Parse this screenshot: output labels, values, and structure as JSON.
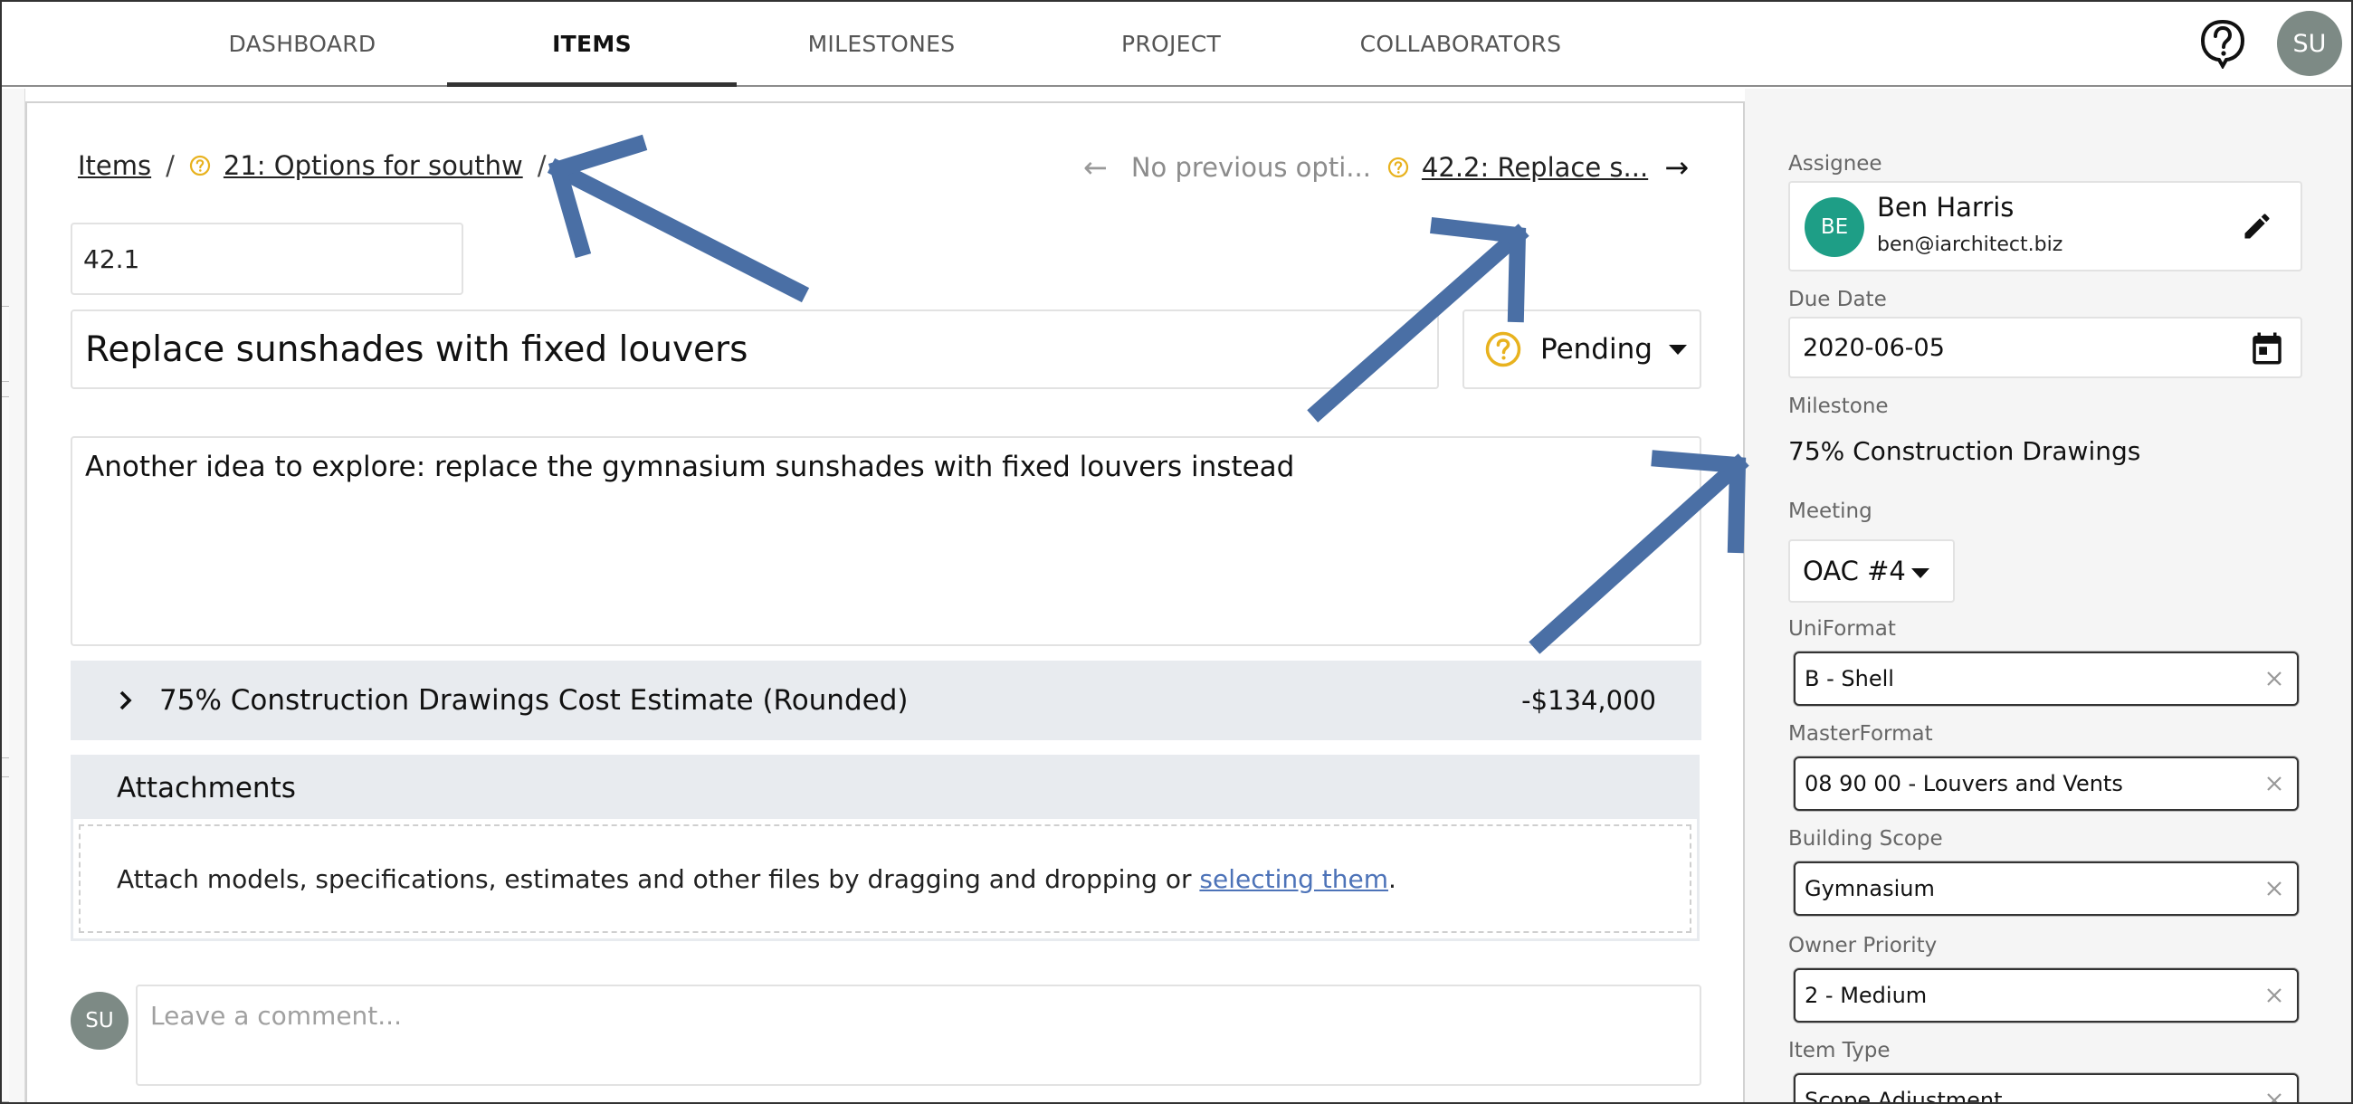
{
  "nav": {
    "tabs": [
      "DASHBOARD",
      "ITEMS",
      "MILESTONES",
      "PROJECT",
      "COLLABORATORS"
    ],
    "active_tab": "ITEMS",
    "user_initials": "SU"
  },
  "breadcrumb": {
    "root": "Items",
    "separator": "/",
    "parent": "21: Options for southw"
  },
  "option_nav": {
    "prev_arrow": "←",
    "prev_text": "No previous opti...",
    "next_text": "42.2: Replace s...",
    "next_arrow": "→"
  },
  "item": {
    "number": "42.1",
    "title": "Replace sunshades with fixed louvers",
    "status": "Pending",
    "description": "Another idea to explore: replace the gymnasium sunshades with fixed louvers instead"
  },
  "cost": {
    "label": "75% Construction Drawings Cost Estimate (Rounded)",
    "amount": "-$134,000"
  },
  "attachments": {
    "title": "Attachments",
    "drop_text": "Attach models, specifications, estimates and other files by dragging and dropping or ",
    "link_text": "selecting them",
    "end_text": "."
  },
  "comment": {
    "initials": "SU",
    "placeholder": "Leave a comment..."
  },
  "sidebar": {
    "assignee_label": "Assignee",
    "assignee": {
      "initials": "BE",
      "name": "Ben Harris",
      "email": "ben@iarchitect.biz",
      "avatar_color": "#1e9e86"
    },
    "due_date_label": "Due Date",
    "due_date": "2020-06-05",
    "milestone_label": "Milestone",
    "milestone": "75% Construction Drawings",
    "meeting_label": "Meeting",
    "meeting": "OAC #4",
    "uniformat_label": "UniFormat",
    "uniformat": "B - Shell",
    "masterformat_label": "MasterFormat",
    "masterformat": "08 90 00 - Louvers and Vents",
    "building_scope_label": "Building Scope",
    "building_scope": "Gymnasium",
    "owner_priority_label": "Owner Priority",
    "owner_priority": "2 - Medium",
    "item_type_label": "Item Type",
    "item_type": "Scope Adjustment"
  },
  "colors": {
    "accent_yellow": "#e8b21e",
    "link_blue": "#4d73b8",
    "annotation_arrow": "#4a6fa5"
  }
}
